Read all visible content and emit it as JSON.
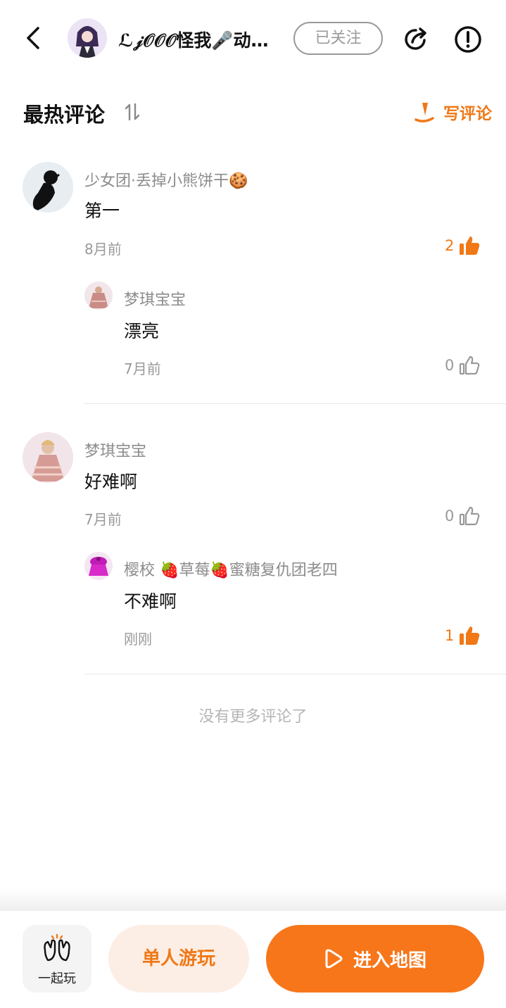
{
  "header": {
    "name": "ℒ𝒿𝒪𝒪𝒪怪我🎤动…",
    "follow_label": "已关注"
  },
  "section": {
    "title": "最热评论",
    "write_label": "写评论"
  },
  "comments": [
    {
      "username": "少女团·丢掉小熊饼干🍪",
      "text": "第一",
      "time": "8月前",
      "likes": "2",
      "reply": {
        "username": "梦琪宝宝",
        "text": "漂亮",
        "time": "7月前",
        "likes": "0"
      }
    },
    {
      "username": "梦琪宝宝",
      "text": "好难啊",
      "time": "7月前",
      "likes": "0",
      "reply": {
        "username": "樱校 🍓草莓🍓蜜糖复仇团老四",
        "text": "不难啊",
        "time": "刚刚",
        "likes": "1"
      }
    }
  ],
  "footer_note": "没有更多评论了",
  "bottom": {
    "together_label": "一起玩",
    "solo_label": "单人游玩",
    "enter_label": "进入地图"
  },
  "colors": {
    "accent": "#f07816",
    "accent_light": "#fdeee5",
    "muted": "#999999"
  }
}
